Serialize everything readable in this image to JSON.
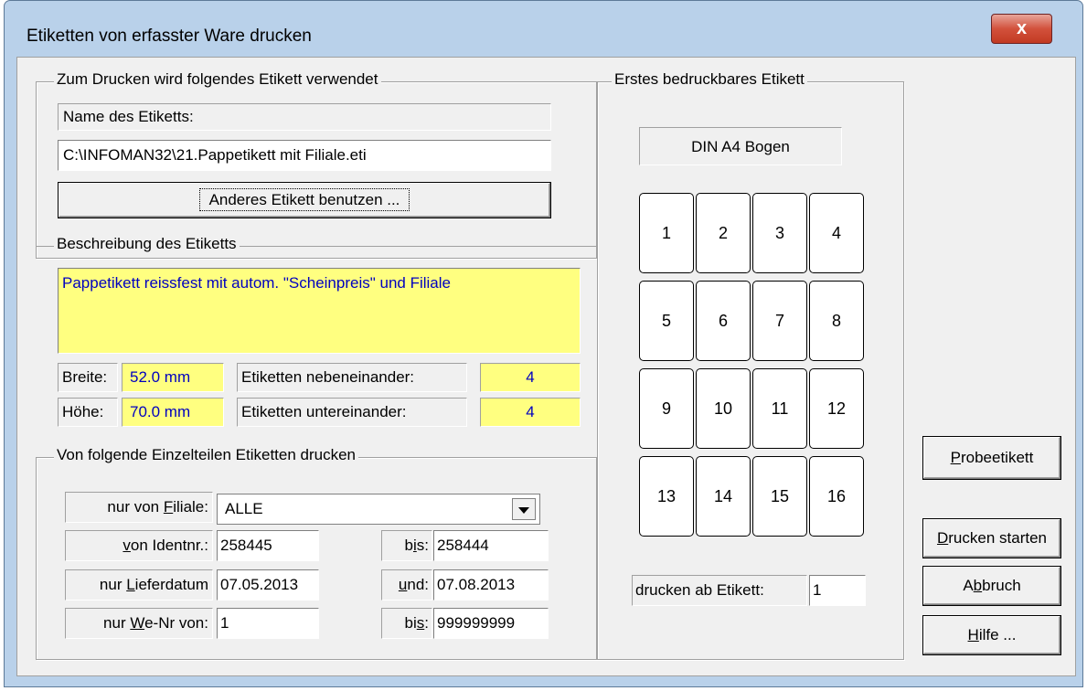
{
  "window": {
    "title": "Etiketten von erfasster Ware drucken",
    "close_label": "x"
  },
  "label_group": {
    "legend": "Zum Drucken wird folgendes Etikett verwendet",
    "name_caption": "Name des Etiketts:",
    "name_value": "C:\\INFOMAN32\\21.Pappetikett mit Filiale.eti",
    "change_button": "Anderes Etikett benutzen ..."
  },
  "description_group": {
    "legend": "Beschreibung des Etiketts",
    "text": "Pappetikett reissfest mit autom. \"Scheinpreis\" und Filiale",
    "width_label": "Breite:",
    "width_value": "52.0 mm",
    "height_label": "Höhe:",
    "height_value": "70.0 mm",
    "across_label": "Etiketten nebeneinander:",
    "across_value": "4",
    "down_label": "Etiketten untereinander:",
    "down_value": "4"
  },
  "filter_group": {
    "legend": "Von folgende Einzelteilen Etiketten drucken",
    "branch_label": "nur von Filiale:",
    "branch_value": "ALLE",
    "id_label": "von Identnr.:",
    "id_from": "258445",
    "id_to_label": "bis:",
    "id_to": "258444",
    "date_label": "nur Lieferdatum",
    "date_from": "07.05.2013",
    "date_and_label": "und:",
    "date_to": "07.08.2013",
    "we_label": "nur We-Nr von:",
    "we_from": "1",
    "we_to_label": "bis:",
    "we_to": "999999999"
  },
  "sheet_group": {
    "legend": "Erstes bedruckbares Etikett",
    "format": "DIN A4 Bogen",
    "cells": [
      "1",
      "2",
      "3",
      "4",
      "5",
      "6",
      "7",
      "8",
      "9",
      "10",
      "11",
      "12",
      "13",
      "14",
      "15",
      "16"
    ],
    "start_label": "drucken ab Etikett:",
    "start_value": "1"
  },
  "buttons": {
    "test": "Probeetikett",
    "print": "Drucken starten",
    "cancel": "Abbruch",
    "help": "Hilfe ..."
  }
}
